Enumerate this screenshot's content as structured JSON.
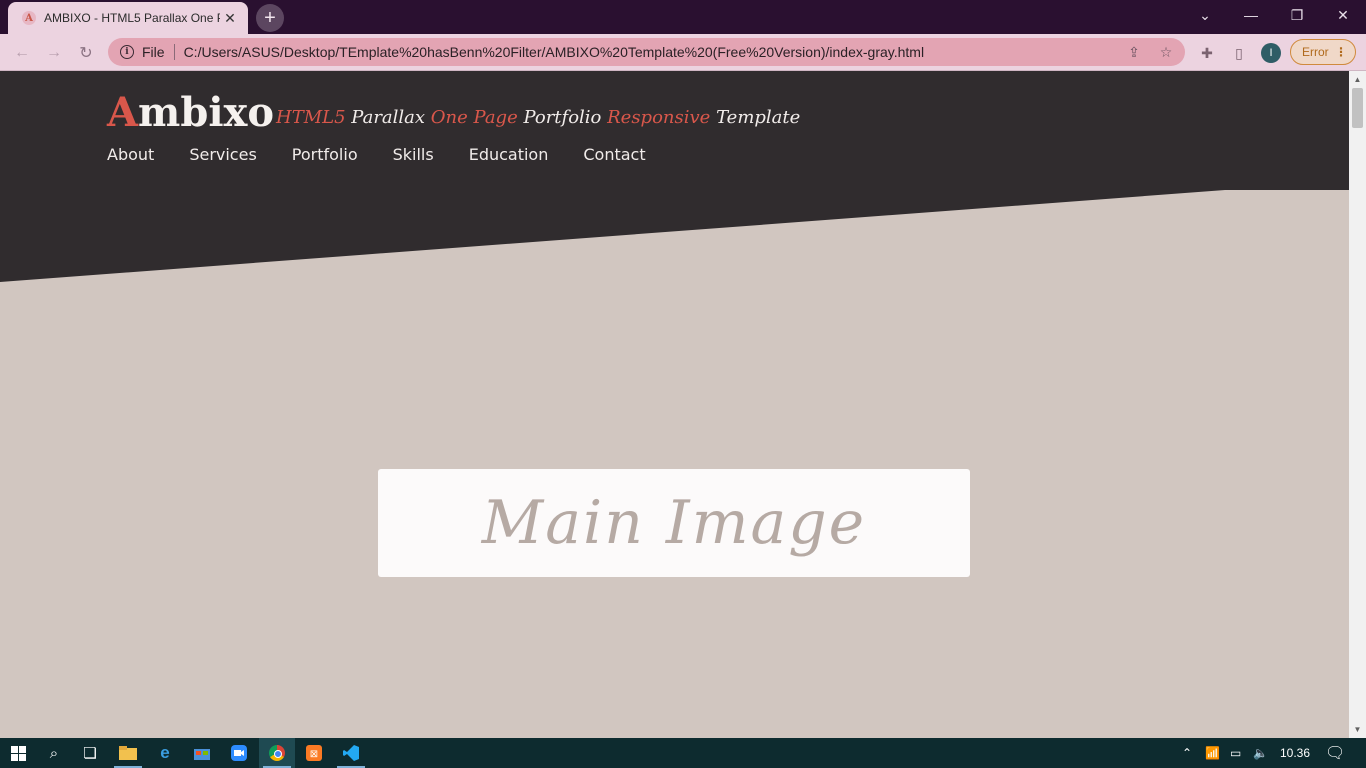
{
  "browser": {
    "tab": {
      "title": "AMBIXO - HTML5 Parallax One P",
      "favicon": "ambixo-favicon"
    },
    "new_tab": "+",
    "address": {
      "scheme_label": "File",
      "url": "C:/Users/ASUS/Desktop/TEmplate%20hasBenn%20Filter/AMBIXO%20Template%20(Free%20Version)/index-gray.html"
    },
    "profile_initial": "I",
    "error_label": "Error"
  },
  "site": {
    "logo_initial": "A",
    "logo_rest": "mbixo",
    "tagline": [
      "HTML5",
      "Parallax",
      "One Page",
      "Portfolio",
      "Responsive",
      "Template"
    ],
    "menu": [
      "About",
      "Services",
      "Portfolio",
      "Skills",
      "Education",
      "Contact"
    ],
    "main_image_label": "Main Image",
    "colors": {
      "header": "#302c2e",
      "accent": "#d9574b",
      "background": "#d1c6c0",
      "image_box": "#fcfafa"
    }
  },
  "taskbar": {
    "time": "10.36"
  }
}
